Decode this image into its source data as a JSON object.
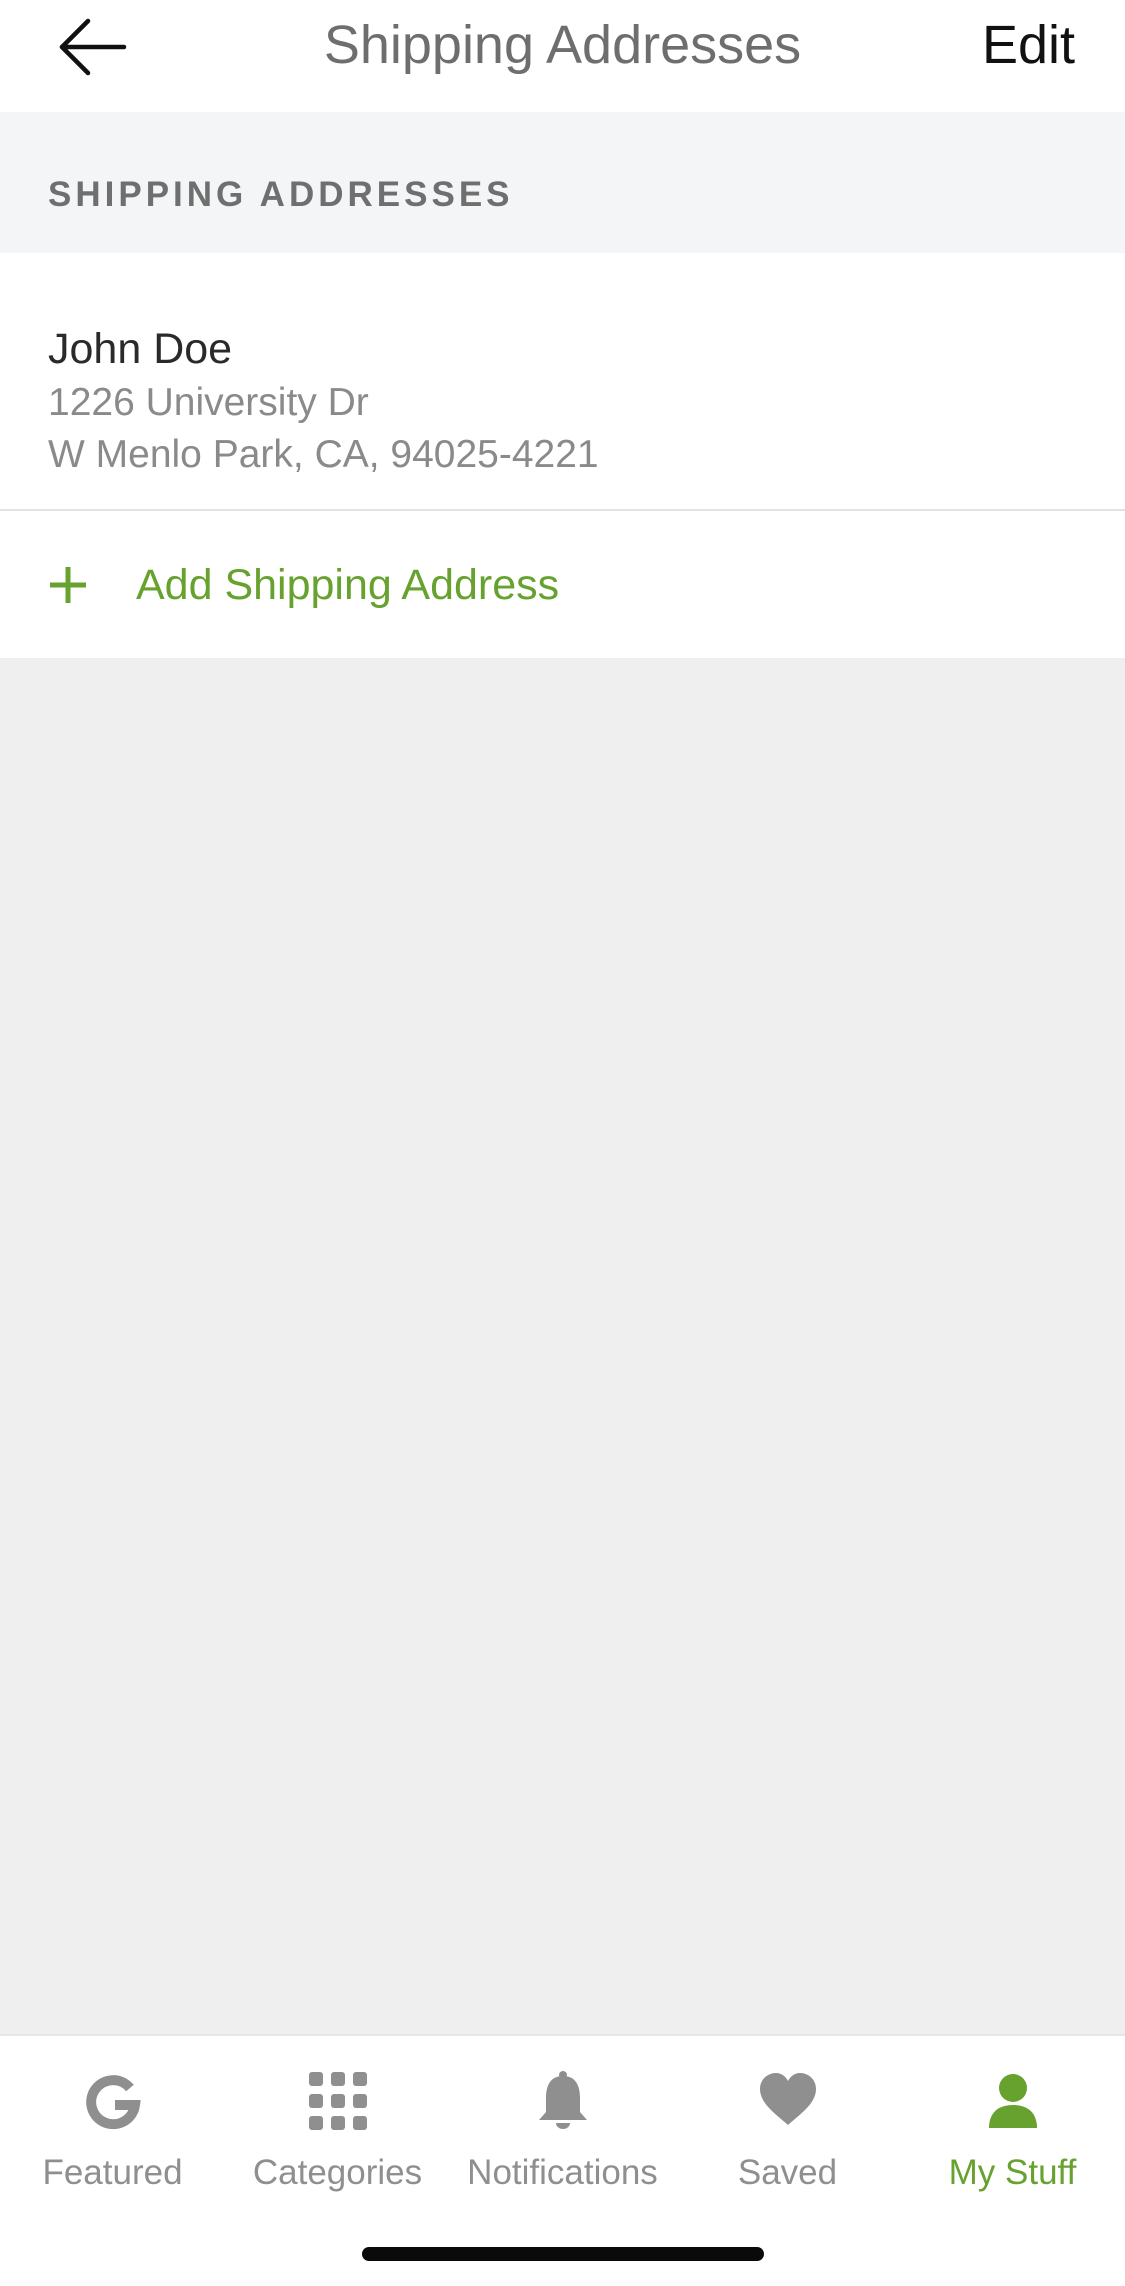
{
  "nav": {
    "title": "Shipping Addresses",
    "edit_label": "Edit",
    "back_icon": "arrow-left-icon"
  },
  "section": {
    "header": "SHIPPING ADDRESSES"
  },
  "addresses": [
    {
      "name": "John Doe",
      "line1": "1226 University Dr",
      "line2": "W Menlo Park, CA, 94025-4221"
    }
  ],
  "add_address": {
    "label": "Add Shipping Address",
    "icon": "plus-icon"
  },
  "tabs": [
    {
      "label": "Featured",
      "icon": "g-logo-icon",
      "active": false
    },
    {
      "label": "Categories",
      "icon": "grid-icon",
      "active": false
    },
    {
      "label": "Notifications",
      "icon": "bell-icon",
      "active": false
    },
    {
      "label": "Saved",
      "icon": "heart-icon",
      "active": false
    },
    {
      "label": "My Stuff",
      "icon": "person-icon",
      "active": true
    }
  ],
  "colors": {
    "accent": "#67a12e",
    "inactive_tab": "#8f8f8f",
    "section_bg": "#f4f5f7",
    "page_bg": "#efefef"
  }
}
